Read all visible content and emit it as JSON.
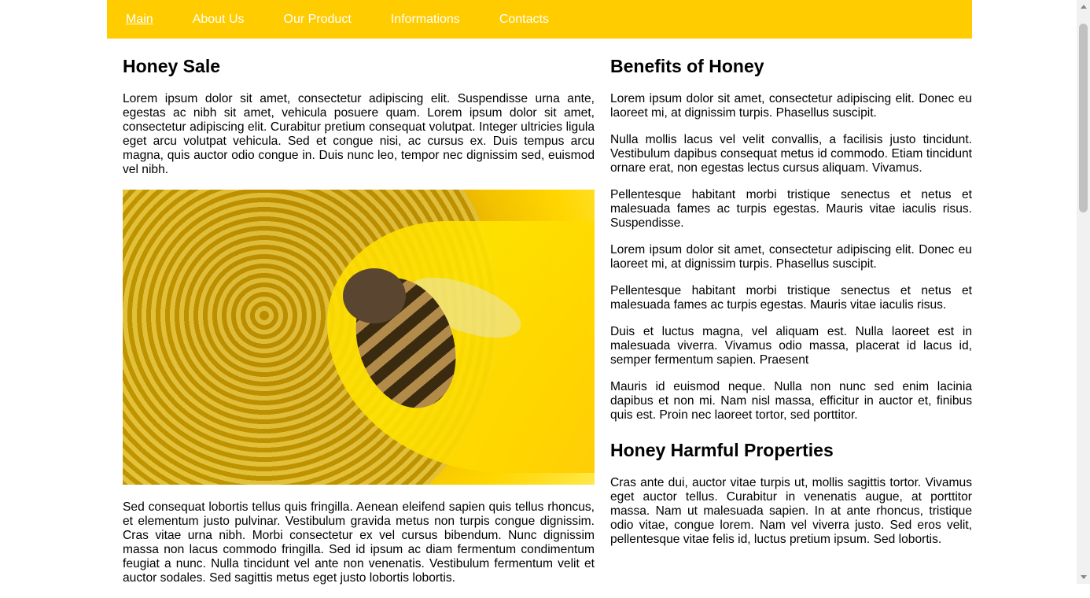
{
  "nav": {
    "items": [
      "Main",
      "About Us",
      "Our Product",
      "Informations",
      "Contacts"
    ],
    "active_index": 0,
    "background_color": "#ffcc00"
  },
  "left": {
    "title": "Honey Sale",
    "intro": "Lorem ipsum dolor sit amet, consectetur adipiscing elit. Suspendisse urna ante, egestas ac nibh sit amet, vehicula posuere quam. Lorem ipsum dolor sit amet, consectetur adipiscing elit. Curabitur pretium consequat volutpat. Integer ultricies ligula eget arcu volutpat vehicula. Sed et congue nisi, ac cursus ex. Duis tempus arcu magna, quis auctor odio congue in. Duis nunc leo, tempor nec dignissim sed, euismod vel nibh.",
    "body": "Sed consequat lobortis tellus quis fringilla. Aenean eleifend sapien quis tellus rhoncus, et elementum justo pulvinar. Vestibulum gravida metus non turpis congue dignissim. Cras vitae urna nibh. Morbi consectetur ex vel cursus bibendum. Nunc dignissim massa non lacus commodo fringilla. Sed id ipsum ac diam fermentum condimentum feugiat a nunc. Nulla tincidunt vel ante non venenatis. Vestibulum fermentum velit et auctor sodales. Sed sagittis metus eget justo lobortis lobortis."
  },
  "right": {
    "benefits_title": "Benefits of Honey",
    "benefits_paragraphs": [
      "Lorem ipsum dolor sit amet, consectetur adipiscing elit. Donec eu laoreet mi, at dignissim turpis. Phasellus suscipit.",
      "Nulla mollis lacus vel velit convallis, a facilisis justo tincidunt. Vestibulum dapibus consequat metus id commodo. Etiam tincidunt ornare erat, non egestas lectus cursus aliquam. Vivamus.",
      "Pellentesque habitant morbi tristique senectus et netus et malesuada fames ac turpis egestas. Mauris vitae iaculis risus. Suspendisse.",
      "Lorem ipsum dolor sit amet, consectetur adipiscing elit. Donec eu laoreet mi, at dignissim turpis. Phasellus suscipit.",
      "Pellentesque habitant morbi tristique senectus et netus et malesuada fames ac turpis egestas. Mauris vitae iaculis risus.",
      "Duis et luctus magna, vel aliquam est. Nulla laoreet est in malesuada viverra. Vivamus odio massa, placerat id lacus id, semper fermentum sapien. Praesent",
      "Mauris id euismod neque. Nulla non nunc sed enim lacinia dapibus et non mi. Nam nisl massa, efficitur in auctor et, finibus quis est. Proin nec laoreet tortor, sed porttitor."
    ],
    "harmful_title": "Honey Harmful Properties",
    "harmful_paragraph": "Cras ante dui, auctor vitae turpis ut, mollis sagittis tortor. Vivamus eget auctor tellus. Curabitur in venenatis augue, at porttitor massa. Nam ut malesuada sapien. In at ante rhoncus, tristique odio vitae, congue lorem. Nam vel viverra justo. Sed eros velit, pellentesque vitae felis id, luctus pretium ipsum. Sed lobortis."
  }
}
